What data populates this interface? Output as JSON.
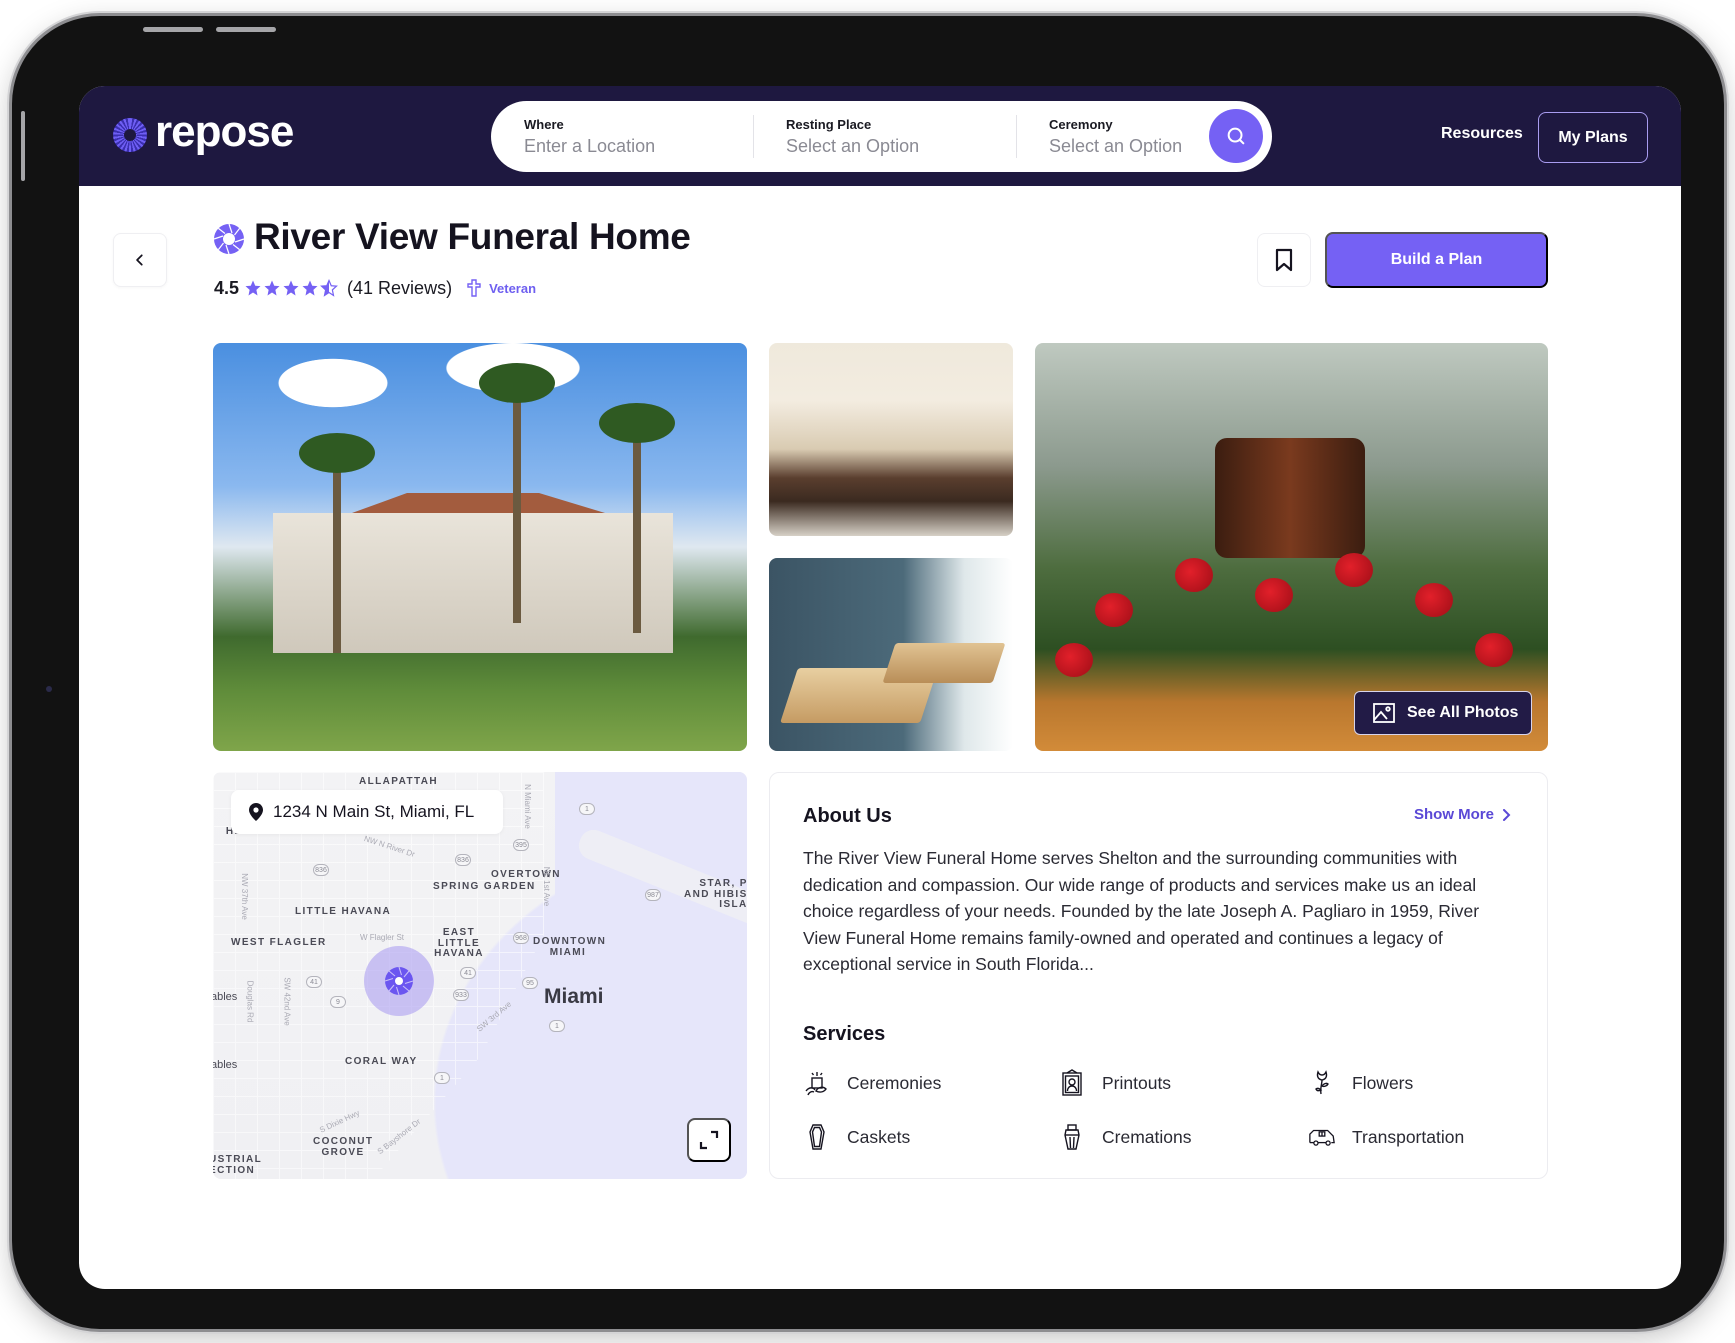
{
  "brand": {
    "name": "repose",
    "accent": "#7561f4",
    "header_bg": "#1e1840"
  },
  "search": {
    "fields": [
      {
        "label": "Where",
        "placeholder": "Enter a Location"
      },
      {
        "label": "Resting Place",
        "placeholder": "Select an Option"
      },
      {
        "label": "Ceremony",
        "placeholder": "Select an Option"
      }
    ],
    "button_icon": "search-icon"
  },
  "nav": {
    "resources": "Resources",
    "my_plans": "My Plans"
  },
  "listing": {
    "title": "River View Funeral Home",
    "rating": "4.5",
    "rating_value": 4.5,
    "rating_max": 5,
    "reviews": "(41 Reviews)",
    "badge": "Veteran",
    "build_plan": "Build a Plan"
  },
  "photos": {
    "items": [
      "exterior",
      "chapel",
      "casket-room",
      "urn-flowers"
    ],
    "see_all": "See All Photos"
  },
  "map": {
    "address": "1234 N Main St, Miami, FL",
    "city": "Miami",
    "neighborhoods": [
      "ALLAPATTAH",
      "GRAPELAND HEIGHTS",
      "OVERTOWN",
      "SPRING GARDEN",
      "LITTLE HAVANA",
      "WEST FLAGLER",
      "EAST LITTLE HAVANA",
      "DOWNTOWN MIAMI",
      "STAR, PALM AND HIBISCUS ISLANDS",
      "CORAL WAY",
      "COCONUT GROVE",
      "INDUSTRIAL SECTION",
      "Coral Gables"
    ],
    "streets": [
      "NW N River Dr",
      "W Flagler St",
      "NW 37th Ave",
      "SW 42nd Ave",
      "Douglas Rd",
      "SW 3rd Ave",
      "S Dixie Hwy",
      "S Bayshore Dr",
      "N Miami Ave",
      "NE 1st Ave"
    ],
    "route_shields": [
      "836",
      "836",
      "395",
      "1",
      "987",
      "968",
      "41",
      "41",
      "933",
      "9",
      "95",
      "1",
      "1"
    ]
  },
  "about": {
    "title": "About Us",
    "show_more": "Show More",
    "text": "The River View Funeral Home serves Shelton and the surrounding communities with dedication and compassion. Our wide range of products and services make us an ideal choice regardless of your needs. Founded by the late Joseph A. Pagliaro in 1959, River View Funeral Home remains family-owned and operated and continues a legacy of exceptional service in South Florida..."
  },
  "services": {
    "title": "Services",
    "items": [
      {
        "label": "Ceremonies",
        "icon": "candle-icon"
      },
      {
        "label": "Printouts",
        "icon": "portrait-frame-icon"
      },
      {
        "label": "Flowers",
        "icon": "rose-icon"
      },
      {
        "label": "Caskets",
        "icon": "casket-icon"
      },
      {
        "label": "Cremations",
        "icon": "urn-icon"
      },
      {
        "label": "Transportation",
        "icon": "van-icon"
      }
    ]
  }
}
